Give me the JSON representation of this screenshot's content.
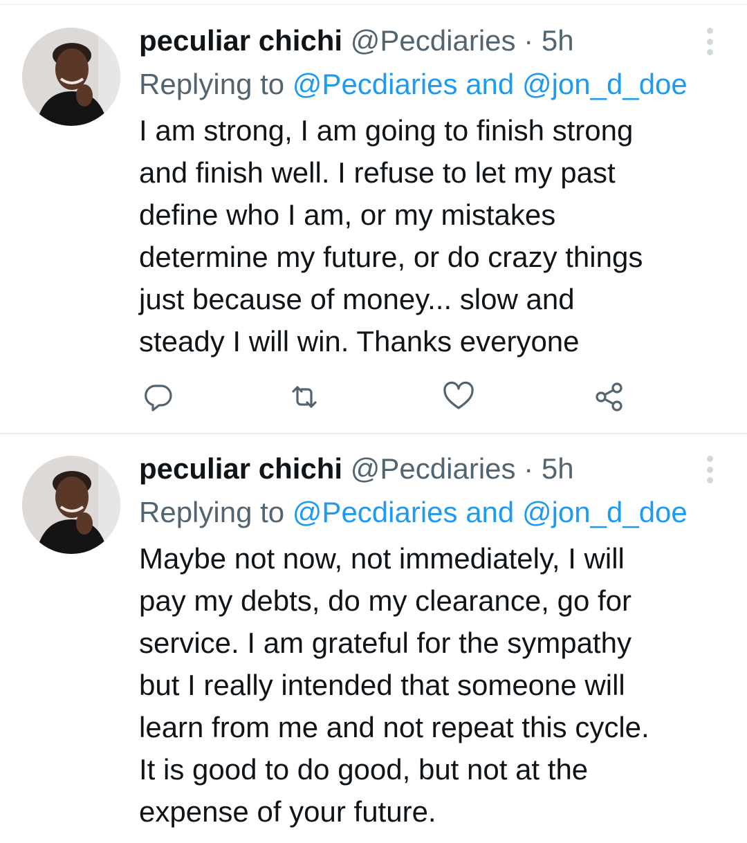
{
  "tweets": [
    {
      "author_name": "peculiar chichi",
      "handle": "@Pecdiaries",
      "separator": "·",
      "time": "5h",
      "replying_prefix": "Replying to ",
      "replying_to": "@Pecdiaries and @jon_d_doe",
      "text": "I am strong, I am going to finish strong\nand finish well. I refuse to let my past\ndefine who I am, or my mistakes\ndetermine my future, or do crazy things\njust because of money... slow and\nsteady I will win. Thanks everyone",
      "actions": [
        "reply-icon",
        "retweet-icon",
        "like-icon",
        "share-icon"
      ]
    },
    {
      "author_name": "peculiar chichi",
      "handle": "@Pecdiaries",
      "separator": "·",
      "time": "5h",
      "replying_prefix": "Replying to ",
      "replying_to": "@Pecdiaries and @jon_d_doe",
      "text": "Maybe not now, not immediately, I will\npay my debts, do my clearance, go for\nservice. I am grateful for the sympathy\nbut I really intended that someone will\nlearn from me and not repeat this cycle.\nIt is good to do good, but not at the\nexpense of your future."
    }
  ],
  "colors": {
    "text": "#0f1419",
    "secondary": "#536471",
    "link": "#1d9bf0",
    "divider": "#e6ecf0"
  }
}
